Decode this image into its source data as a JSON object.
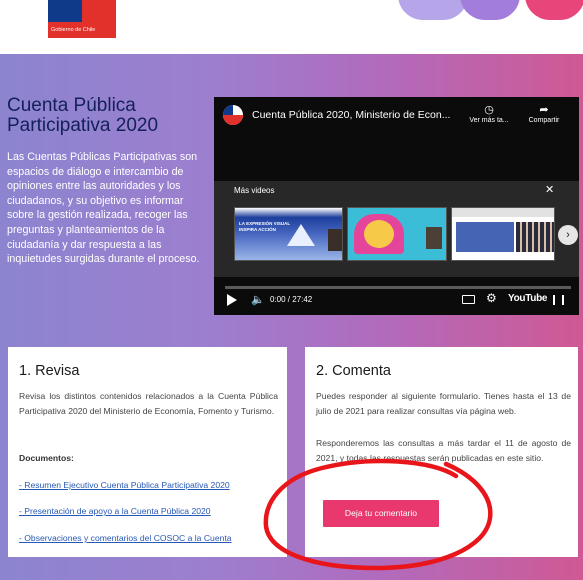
{
  "header": {
    "logo_text": "Gobierno de Chile"
  },
  "hero": {
    "title": "Cuenta Pública Participativa 2020",
    "description": "Las Cuentas Públicas Participativas son espacios de diálogo e intercambio de opiniones entre las autoridades y los ciudadanos, y su objetivo es informar sobre la gestión realizada, recoger las preguntas y planteamientos de la ciudadanía y dar respuesta a las inquietudes surgidas durante el proceso."
  },
  "video": {
    "title": "Cuenta Pública 2020, Ministerio de Econ...",
    "watch_later_label": "Ver más ta...",
    "share_label": "Compartir",
    "more_videos_label": "Más videos",
    "thumb1_text": "LA EXPRESIÓN VISUAL INSPIRA ACCIÓN",
    "time": "0:00 / 27:42",
    "brand": "YouTube",
    "progress": 0
  },
  "card1": {
    "title": "1. Revisa",
    "text": "Revisa los distintos contenidos relacionados a la Cuenta Pública Participativa 2020 del Ministerio de Economía, Fomento y Turismo.",
    "documents_label": "Documentos:",
    "links": [
      "- Resumen Ejecutivo Cuenta Pública Participativa 2020",
      "- Presentación de apoyo a la Cuenta Pública 2020",
      "- Observaciones y comentarios del COSOC a la Cuenta"
    ]
  },
  "card2": {
    "title": "2. Comenta",
    "text1": "Puedes responder al siguiente formulario. Tienes hasta el 13 de julio de 2021 para realizar consultas vía página web.",
    "text2": "Responderemos las consultas a más tardar el 11 de agosto de 2021, y todas las respuestas serán publicadas en este sitio.",
    "button_label": "Deja tu comentario"
  },
  "colors": {
    "accent_pink": "#e8386d",
    "annotation_red": "#e8161b",
    "title_navy": "#14205a"
  }
}
